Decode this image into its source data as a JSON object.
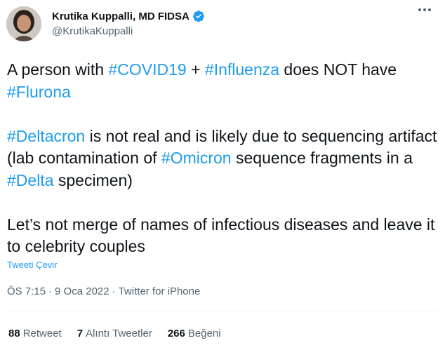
{
  "author": {
    "name": "Krutika Kuppalli, MD FIDSA",
    "handle": "@KrutikaKuppalli",
    "verified_color": "#1d9bf0"
  },
  "tweet": {
    "p1": {
      "t1": "A person with ",
      "h1": "#COVID19",
      "t2": " + ",
      "h2": "#Influenza",
      "t3": " does NOT have ",
      "h3": "#Flurona"
    },
    "p2": {
      "h1": "#Deltacron",
      "t1": " is not real and is likely due to sequencing artifact (lab contamination of ",
      "h2": "#Omicron",
      "t2": " sequence fragments in a ",
      "h3": "#Delta",
      "t3": " specimen)"
    },
    "p3": {
      "t1": "Let’s not merge of names of infectious diseases and leave it to celebrity couples"
    }
  },
  "translate_label": "Tweeti Çevir",
  "meta": {
    "time": "ÖS 7:15",
    "sep1": "·",
    "date": "9 Oca 2022",
    "sep2": "·",
    "source": "Twitter for iPhone"
  },
  "stats": {
    "retweets": {
      "count": "88",
      "label": "Retweet"
    },
    "quotes": {
      "count": "7",
      "label": "Alıntı Tweetler"
    },
    "likes": {
      "count": "266",
      "label": "Beğeni"
    }
  },
  "colors": {
    "link": "#1d9bf0",
    "text": "#0f1419",
    "muted": "#536471"
  }
}
